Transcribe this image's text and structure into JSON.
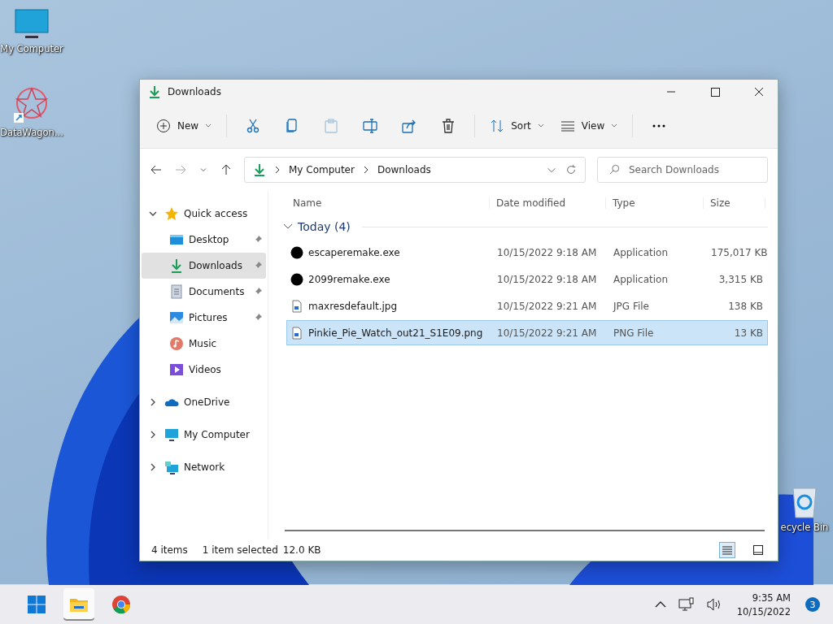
{
  "desktop_icons": [
    {
      "label": "My Computer",
      "kind": "computer"
    },
    {
      "label": "DataWagon...",
      "kind": "shortcut"
    },
    {
      "label": "ecycle Bin",
      "kind": "recycle"
    }
  ],
  "window": {
    "title": "Downloads"
  },
  "toolbar": {
    "new_label": "New",
    "buttons": [
      {
        "kind": "cut",
        "disabled": false
      },
      {
        "kind": "copy",
        "disabled": false
      },
      {
        "kind": "paste",
        "disabled": true
      },
      {
        "kind": "rename",
        "disabled": false
      },
      {
        "kind": "share",
        "disabled": false
      },
      {
        "kind": "delete",
        "disabled": false
      }
    ],
    "sort_label": "Sort",
    "view_label": "View"
  },
  "address_bar": {
    "breadcrumb": [
      "My Computer",
      "Downloads"
    ]
  },
  "search": {
    "placeholder": "Search Downloads"
  },
  "sidebar": {
    "items": [
      {
        "label": "Quick access",
        "kind": "star",
        "expanded": true,
        "selected": false,
        "children": [
          {
            "label": "Desktop",
            "kind": "desktop",
            "pinned": true,
            "selected": false
          },
          {
            "label": "Downloads",
            "kind": "download",
            "pinned": true,
            "selected": true
          },
          {
            "label": "Documents",
            "kind": "documents",
            "pinned": true,
            "selected": false
          },
          {
            "label": "Pictures",
            "kind": "pictures",
            "pinned": true,
            "selected": false
          },
          {
            "label": "Music",
            "kind": "music",
            "pinned": false,
            "selected": false
          },
          {
            "label": "Videos",
            "kind": "videos",
            "pinned": false,
            "selected": false
          }
        ]
      },
      {
        "label": "OneDrive",
        "kind": "cloud",
        "expanded": false,
        "selected": false
      },
      {
        "label": "My Computer",
        "kind": "computer",
        "expanded": false,
        "selected": false
      },
      {
        "label": "Network",
        "kind": "network",
        "expanded": false,
        "selected": false
      }
    ]
  },
  "table": {
    "columns": [
      "Name",
      "Date modified",
      "Type",
      "Size"
    ],
    "group": {
      "label": "Today (4)",
      "expanded": true
    },
    "rows": [
      {
        "name": "escaperemake.exe",
        "date": "10/15/2022 9:18 AM",
        "type": "Application",
        "size": "175,017 KB",
        "kind": "app",
        "selected": false
      },
      {
        "name": "2099remake.exe",
        "date": "10/15/2022 9:18 AM",
        "type": "Application",
        "size": "3,315 KB",
        "kind": "app",
        "selected": false
      },
      {
        "name": "maxresdefault.jpg",
        "date": "10/15/2022 9:21 AM",
        "type": "JPG File",
        "size": "138 KB",
        "kind": "image",
        "selected": false
      },
      {
        "name": "Pinkie_Pie_Watch_out21_S1E09.png",
        "date": "10/15/2022 9:21 AM",
        "type": "PNG File",
        "size": "13 KB",
        "kind": "image",
        "selected": true
      }
    ]
  },
  "status_bar": {
    "count": "4 items",
    "selection": "1 item selected",
    "size": "12.0 KB",
    "views": [
      {
        "kind": "details",
        "selected": true
      },
      {
        "kind": "tiles",
        "selected": false
      }
    ]
  },
  "taskbar": {
    "apps": [
      {
        "kind": "start",
        "active": false
      },
      {
        "kind": "explorer",
        "active": true
      },
      {
        "kind": "browser",
        "active": false
      }
    ],
    "time": "9:35 AM",
    "date": "10/15/2022",
    "notifications": "3"
  }
}
